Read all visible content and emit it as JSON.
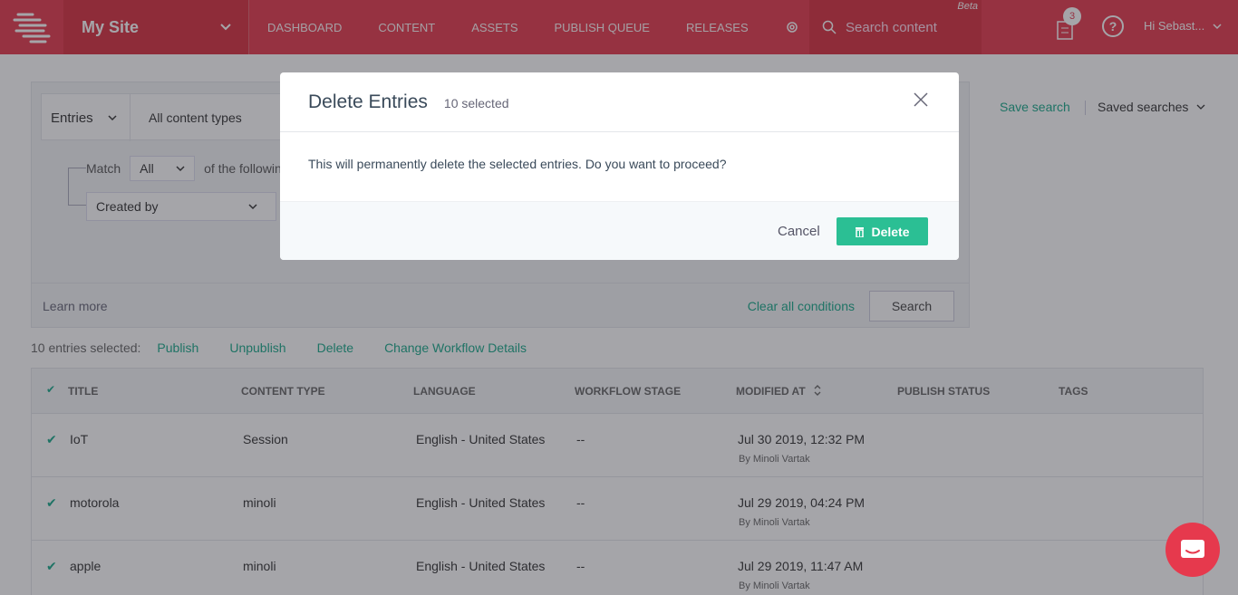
{
  "topbar": {
    "site_name": "My Site",
    "nav": [
      "DASHBOARD",
      "CONTENT",
      "ASSETS",
      "PUBLISH QUEUE",
      "RELEASES"
    ],
    "search_placeholder": "Search content",
    "beta": "Beta",
    "tasks_count": "3",
    "help": "?",
    "user": "Hi  Sebast..."
  },
  "filters": {
    "entries_label": "Entries",
    "content_types": "All content types",
    "match_label": "Match",
    "match_value": "All",
    "of_following": "of the followin",
    "created_by": "Created by",
    "learn_more": "Learn more",
    "clear_all": "Clear all conditions",
    "search_button": "Search",
    "save_search": "Save search",
    "saved_searches": "Saved searches"
  },
  "bulk_actions": {
    "selected": "10 entries selected:",
    "actions": [
      "Publish",
      "Unpublish",
      "Delete",
      "Change Workflow Details"
    ]
  },
  "table": {
    "columns": [
      "TITLE",
      "CONTENT TYPE",
      "LANGUAGE",
      "WORKFLOW STAGE",
      "MODIFIED AT",
      "PUBLISH STATUS",
      "TAGS"
    ],
    "rows": [
      {
        "title": "IoT",
        "content_type": "Session",
        "language": "English - United States",
        "workflow": "--",
        "modified": "Jul 30 2019, 12:32 PM",
        "by": "By Minoli Vartak"
      },
      {
        "title": "motorola",
        "content_type": "minoli",
        "language": "English - United States",
        "workflow": "--",
        "modified": "Jul 29 2019, 04:24 PM",
        "by": "By Minoli Vartak"
      },
      {
        "title": "apple",
        "content_type": "minoli",
        "language": "English - United States",
        "workflow": "--",
        "modified": "Jul 29 2019, 11:47 AM",
        "by": "By Minoli Vartak"
      }
    ]
  },
  "modal": {
    "title": "Delete Entries",
    "count": "10 selected",
    "message": "This will permanently delete the selected entries. Do you want to proceed?",
    "cancel": "Cancel",
    "delete": "Delete"
  },
  "colors": {
    "brand": "#e6394d",
    "accent": "#2bbf94"
  }
}
